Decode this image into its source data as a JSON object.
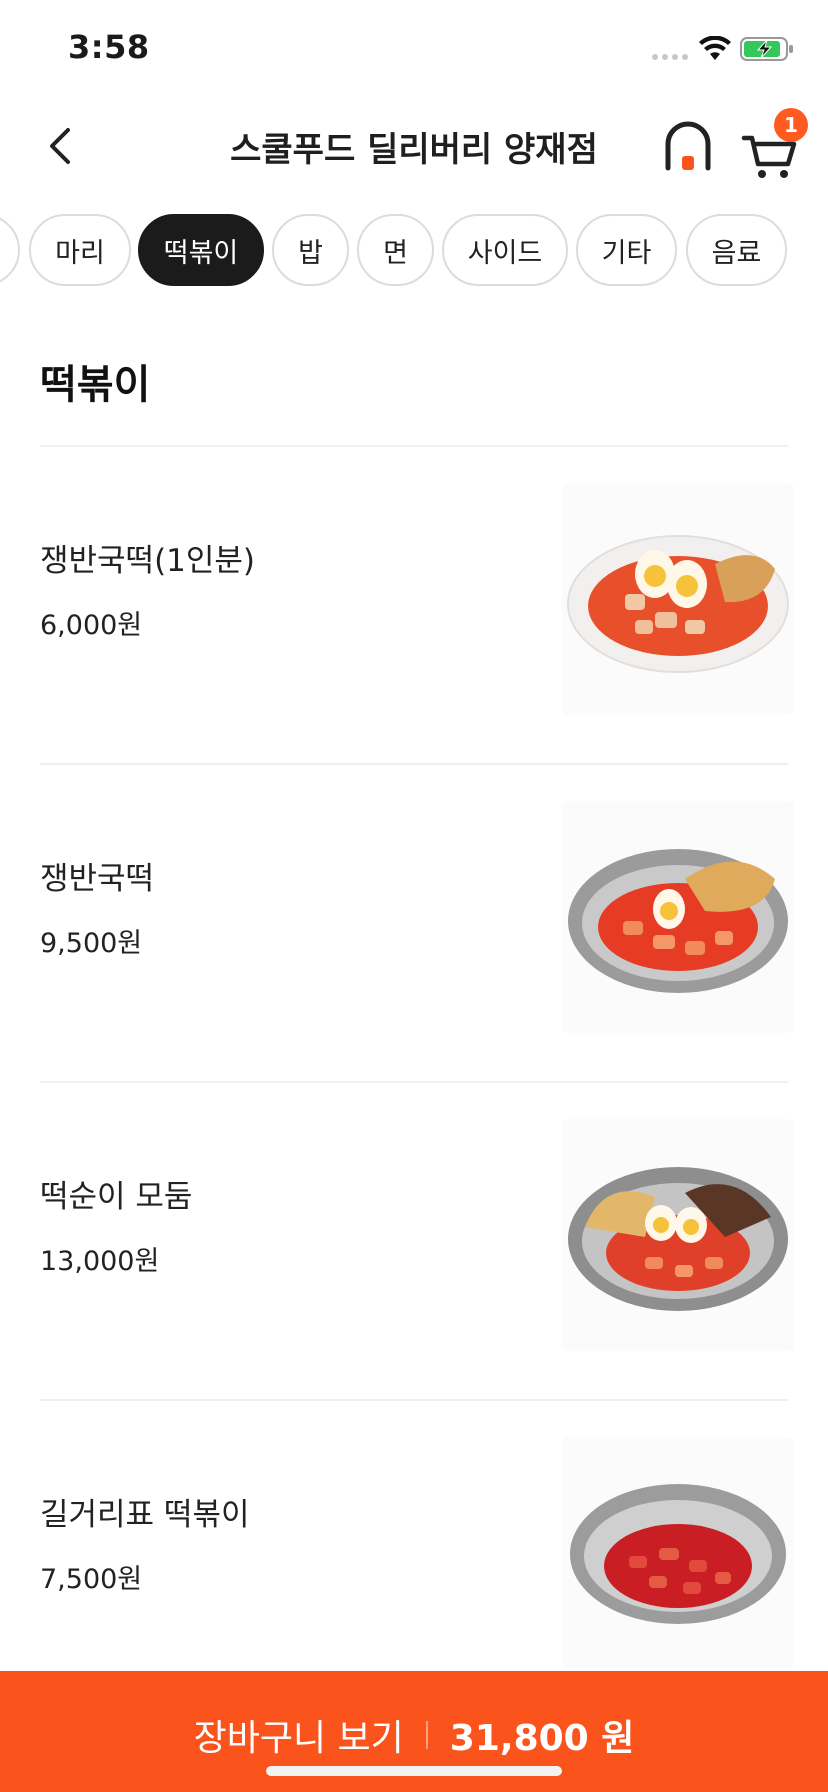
{
  "status_bar": {
    "time": "3:58"
  },
  "header": {
    "title": "스쿨푸드 딜리버리 양재점",
    "cart_badge": "1"
  },
  "tabs": [
    {
      "label": "마리"
    },
    {
      "label": "떡볶이",
      "active": true
    },
    {
      "label": "밥"
    },
    {
      "label": "면"
    },
    {
      "label": "사이드"
    },
    {
      "label": "기타"
    },
    {
      "label": "음료"
    }
  ],
  "section": {
    "title": "떡볶이"
  },
  "menu_items": [
    {
      "name": "쟁반국떡(1인분)",
      "price": "6,000원",
      "image": "tteokbokki-white-bowl-image"
    },
    {
      "name": "쟁반국떡",
      "price": "9,500원",
      "image": "tteokbokki-steel-bowl-image"
    },
    {
      "name": "떡순이 모둠",
      "price": "13,000원",
      "image": "tteokbokki-platter-image"
    },
    {
      "name": "길거리표 떡볶이",
      "price": "7,500원",
      "image": "street-tteokbokki-image"
    }
  ],
  "cart_bar": {
    "label": "장바구니 보기",
    "total": "31,800 원"
  },
  "colors": {
    "accent": "#fa541c",
    "badge": "#ff5a1f",
    "active_tab": "#1b1b1b"
  }
}
